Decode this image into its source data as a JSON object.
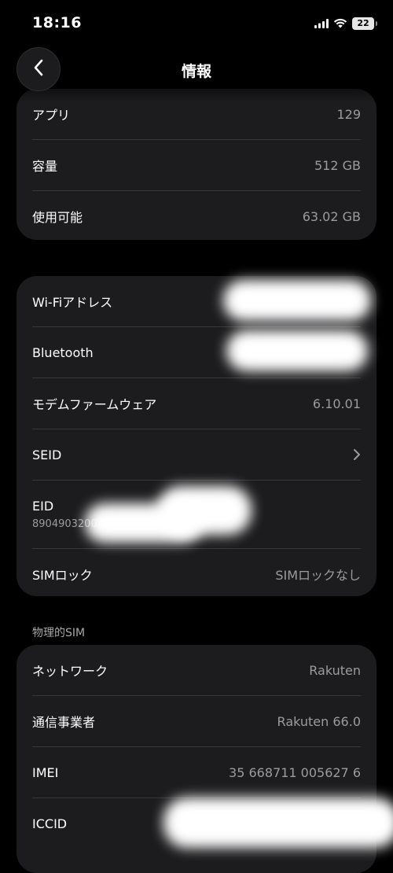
{
  "status_bar": {
    "time": "18:16",
    "battery": "22"
  },
  "nav": {
    "title": "情報"
  },
  "storage_card": [
    {
      "label": "アプリ",
      "value": "129"
    },
    {
      "label": "容量",
      "value": "512 GB"
    },
    {
      "label": "使用可能",
      "value": "63.02 GB"
    }
  ],
  "network_card": {
    "wifi": {
      "label": "Wi-Fiアドレス",
      "value": ""
    },
    "bluetooth": {
      "label": "Bluetooth",
      "value": ""
    },
    "modem": {
      "label": "モデムファームウェア",
      "value": "6.10.01"
    },
    "seid": {
      "label": "SEID"
    },
    "eid": {
      "label": "EID",
      "value": "8904903200 … 7309"
    },
    "sim_lock": {
      "label": "SIMロック",
      "value": "SIMロックなし"
    }
  },
  "physical_sim": {
    "header": "物理的SIM",
    "network": {
      "label": "ネットワーク",
      "value": "Rakuten"
    },
    "carrier": {
      "label": "通信事業者",
      "value": "Rakuten 66.0"
    },
    "imei": {
      "label": "IMEI",
      "value": "35 668711 005627 6"
    },
    "iccid": {
      "label": "ICCID",
      "value": ""
    }
  },
  "colors": {
    "background": "#000000",
    "card": "#1c1c1e",
    "separator": "#38383a",
    "secondary_text": "#9c9c9f"
  },
  "icons": [
    "signal-icon",
    "wifi-icon",
    "battery-icon",
    "back-chevron-icon",
    "chevron-right-icon"
  ]
}
